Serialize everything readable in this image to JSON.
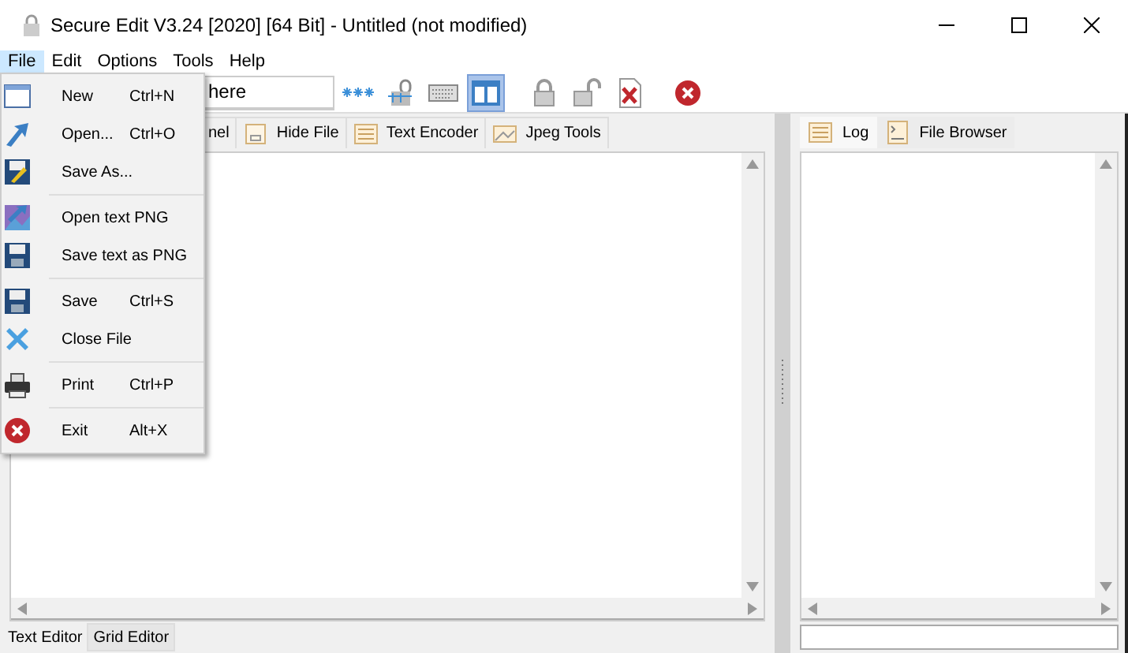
{
  "window": {
    "title": "Secure Edit V3.24 [2020] [64 Bit] - Untitled (not modified)"
  },
  "menu_bar": [
    {
      "label": "File",
      "selected": true
    },
    {
      "label": "Edit",
      "selected": false
    },
    {
      "label": "Options",
      "selected": false
    },
    {
      "label": "Tools",
      "selected": false
    },
    {
      "label": "Help",
      "selected": false
    }
  ],
  "file_menu": [
    {
      "items": [
        {
          "label": "New",
          "shortcut": "Ctrl+N"
        },
        {
          "label": "Open...",
          "shortcut": "Ctrl+O"
        },
        {
          "label": "Save As..."
        }
      ]
    },
    {
      "items": [
        {
          "label": "Open text PNG"
        },
        {
          "label": "Save text as PNG"
        }
      ]
    },
    {
      "items": [
        {
          "label": "Save",
          "shortcut": "Ctrl+S"
        },
        {
          "label": "Close File"
        }
      ]
    },
    {
      "items": [
        {
          "label": "Print",
          "shortcut": "Ctrl+P"
        }
      ]
    },
    {
      "items": [
        {
          "label": "Exit",
          "shortcut": "Alt+X"
        }
      ]
    }
  ],
  "password_field": {
    "value": "here"
  },
  "toolbar": [
    {
      "kind": "asterisks",
      "pressed": false
    },
    {
      "kind": "key",
      "pressed": false
    },
    {
      "kind": "keyboard",
      "pressed": false
    },
    {
      "kind": "layout",
      "pressed": true
    },
    {
      "kind": "lock",
      "pressed": false
    },
    {
      "kind": "unlock",
      "pressed": false
    },
    {
      "kind": "file-x",
      "pressed": false
    },
    {
      "kind": "stop",
      "pressed": false
    }
  ],
  "left_tabs": [
    {
      "label": "nel",
      "selected": false
    },
    {
      "label": "Hide File",
      "selected": false
    },
    {
      "label": "Text Encoder",
      "selected": false
    },
    {
      "label": "Jpeg Tools",
      "selected": false
    }
  ],
  "right_tabs": [
    {
      "label": "Log",
      "selected": true
    },
    {
      "label": "File Browser",
      "selected": false
    }
  ],
  "bottom_tabs": [
    {
      "label": "Text Editor",
      "selected": true
    },
    {
      "label": "Grid Editor",
      "selected": false
    }
  ]
}
